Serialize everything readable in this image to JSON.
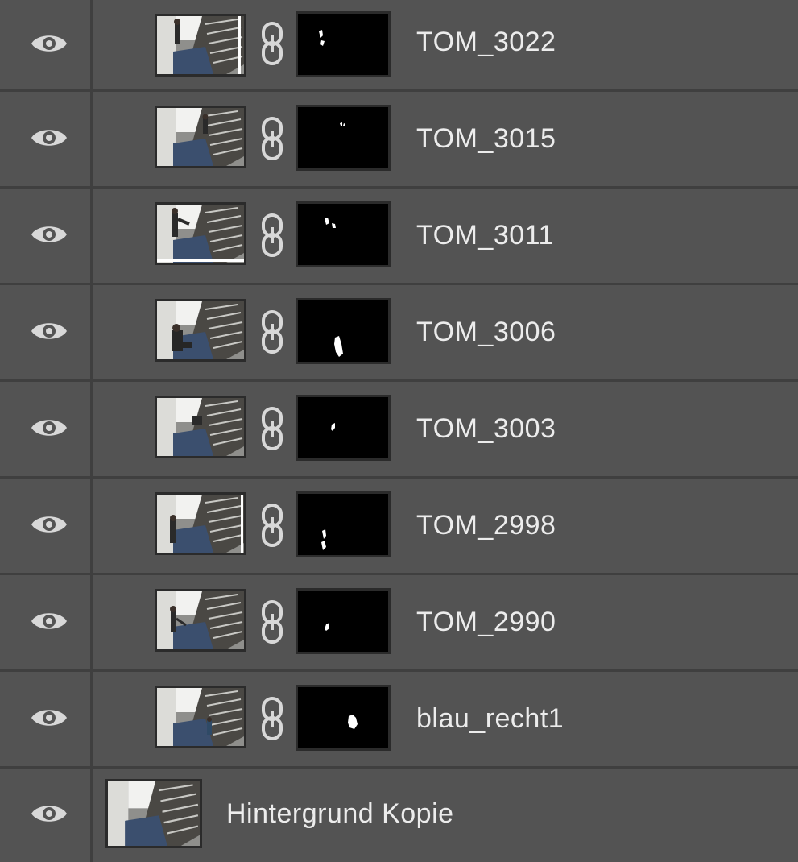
{
  "panel": {
    "colors": {
      "background": "#535353",
      "separator": "#3f3f3f",
      "text": "#ececec",
      "icon": "#d8d8d8",
      "mask_background": "#000000",
      "mask_shape": "#ffffff"
    },
    "layers": [
      {
        "name": "TOM_3022",
        "visible": true,
        "has_mask": true,
        "thumb_icon": "stairwell-photo",
        "mask_icon": "white-figure-shape"
      },
      {
        "name": "TOM_3015",
        "visible": true,
        "has_mask": true,
        "thumb_icon": "stairwell-photo",
        "mask_icon": "white-figure-shape"
      },
      {
        "name": "TOM_3011",
        "visible": true,
        "has_mask": true,
        "thumb_icon": "stairwell-photo",
        "mask_icon": "white-figure-shape"
      },
      {
        "name": "TOM_3006",
        "visible": true,
        "has_mask": true,
        "thumb_icon": "stairwell-photo",
        "mask_icon": "white-figure-shape"
      },
      {
        "name": "TOM_3003",
        "visible": true,
        "has_mask": true,
        "thumb_icon": "stairwell-photo",
        "mask_icon": "white-figure-shape"
      },
      {
        "name": "TOM_2998",
        "visible": true,
        "has_mask": true,
        "thumb_icon": "stairwell-photo",
        "mask_icon": "white-figure-shape"
      },
      {
        "name": "TOM_2990",
        "visible": true,
        "has_mask": true,
        "thumb_icon": "stairwell-photo",
        "mask_icon": "white-figure-shape"
      },
      {
        "name": "blau_recht1",
        "visible": true,
        "has_mask": true,
        "thumb_icon": "stairwell-photo",
        "mask_icon": "white-figure-shape"
      },
      {
        "name": "Hintergrund Kopie",
        "visible": true,
        "has_mask": false,
        "thumb_icon": "stairwell-photo"
      }
    ]
  }
}
